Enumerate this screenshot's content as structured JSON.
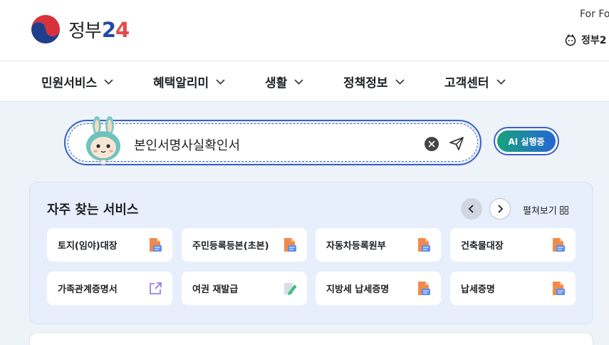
{
  "header": {
    "logo_text": "정부",
    "logo_num_a": "2",
    "logo_num_b": "4",
    "for_foreigners": "For Fo",
    "sub_label": "정부2"
  },
  "gnb": {
    "items": [
      {
        "label": "민원서비스"
      },
      {
        "label": "혜택알리미"
      },
      {
        "label": "생활"
      },
      {
        "label": "정책정보"
      },
      {
        "label": "고객센터"
      }
    ]
  },
  "search": {
    "value": "본인서명사실확인서",
    "ai_label": "AI 실행중"
  },
  "services": {
    "title": "자주 찾는 서비스",
    "expand_label": "펼쳐보기",
    "tiles": [
      {
        "label": "토지(임야)대장",
        "icon": "document-file-icon"
      },
      {
        "label": "주민등록등본(초본)",
        "icon": "document-file-icon"
      },
      {
        "label": "자동차등록원부",
        "icon": "document-file-icon"
      },
      {
        "label": "건축물대장",
        "icon": "document-file-icon"
      },
      {
        "label": "가족관계증명서",
        "icon": "external-link-icon"
      },
      {
        "label": "여권 재발급",
        "icon": "edit-document-icon"
      },
      {
        "label": "지방세 납세증명",
        "icon": "document-file-icon"
      },
      {
        "label": "납세증명",
        "icon": "document-file-icon"
      }
    ]
  },
  "colors": {
    "accent": "#3a5ec9",
    "ai_gradient_start": "#17a37d",
    "ai_gradient_end": "#2566d6",
    "doc_icon": "#f08a4b",
    "link_icon": "#8b6cf0",
    "panel_bg": "#e6effb"
  }
}
